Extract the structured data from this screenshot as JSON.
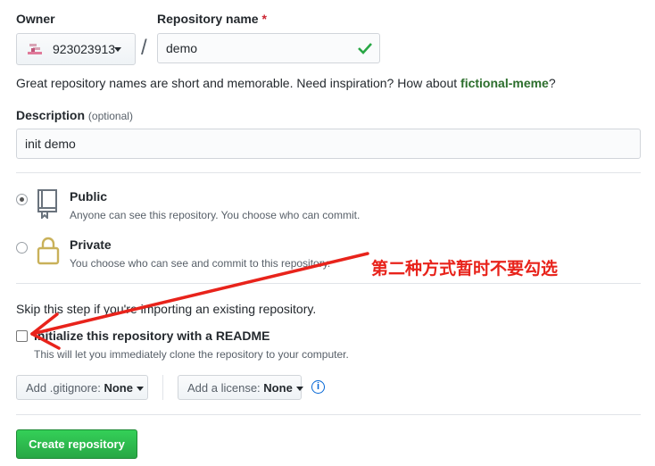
{
  "owner": {
    "label": "Owner",
    "value": "923023913"
  },
  "repo_name": {
    "label": "Repository name",
    "required_mark": "*",
    "value": "demo"
  },
  "separator": "/",
  "hint": {
    "prefix": "Great repository names are short and memorable. Need inspiration? How about ",
    "suggestion": "fictional-meme",
    "suffix": "?"
  },
  "description": {
    "label": "Description",
    "optional": "(optional)",
    "value": "init demo"
  },
  "visibility": {
    "public": {
      "title": "Public",
      "desc": "Anyone can see this repository. You choose who can commit.",
      "selected": true
    },
    "private": {
      "title": "Private",
      "desc": "You choose who can see and commit to this repository.",
      "selected": false
    }
  },
  "init": {
    "skip_note": "Skip this step if you're importing an existing repository.",
    "readme_label": "Initialize this repository with a README",
    "readme_desc": "This will let you immediately clone the repository to your computer.",
    "checked": false
  },
  "gitignore": {
    "label": "Add .gitignore:",
    "value": "None"
  },
  "license": {
    "label": "Add a license:",
    "value": "None"
  },
  "info_icon_text": "i",
  "submit_label": "Create repository",
  "annotation": "第二种方式暂时不要勾选",
  "colors": {
    "accent_green": "#28a745",
    "link_green": "#2c6e2c",
    "annotation_red": "#e8231b",
    "info_blue": "#0366d6"
  }
}
